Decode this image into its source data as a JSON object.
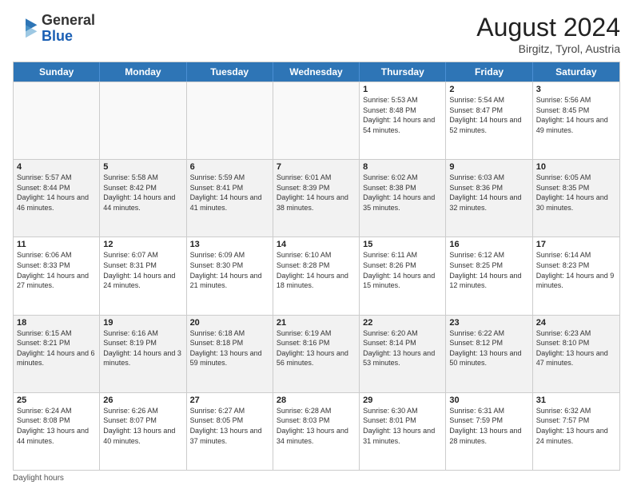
{
  "header": {
    "logo_general": "General",
    "logo_blue": "Blue",
    "month_year": "August 2024",
    "location": "Birgitz, Tyrol, Austria"
  },
  "days_of_week": [
    "Sunday",
    "Monday",
    "Tuesday",
    "Wednesday",
    "Thursday",
    "Friday",
    "Saturday"
  ],
  "weeks": [
    [
      {
        "day": "",
        "empty": true
      },
      {
        "day": "",
        "empty": true
      },
      {
        "day": "",
        "empty": true
      },
      {
        "day": "",
        "empty": true
      },
      {
        "day": "1",
        "sunrise": "5:53 AM",
        "sunset": "8:48 PM",
        "daylight": "14 hours and 54 minutes."
      },
      {
        "day": "2",
        "sunrise": "5:54 AM",
        "sunset": "8:47 PM",
        "daylight": "14 hours and 52 minutes."
      },
      {
        "day": "3",
        "sunrise": "5:56 AM",
        "sunset": "8:45 PM",
        "daylight": "14 hours and 49 minutes."
      }
    ],
    [
      {
        "day": "4",
        "sunrise": "5:57 AM",
        "sunset": "8:44 PM",
        "daylight": "14 hours and 46 minutes."
      },
      {
        "day": "5",
        "sunrise": "5:58 AM",
        "sunset": "8:42 PM",
        "daylight": "14 hours and 44 minutes."
      },
      {
        "day": "6",
        "sunrise": "5:59 AM",
        "sunset": "8:41 PM",
        "daylight": "14 hours and 41 minutes."
      },
      {
        "day": "7",
        "sunrise": "6:01 AM",
        "sunset": "8:39 PM",
        "daylight": "14 hours and 38 minutes."
      },
      {
        "day": "8",
        "sunrise": "6:02 AM",
        "sunset": "8:38 PM",
        "daylight": "14 hours and 35 minutes."
      },
      {
        "day": "9",
        "sunrise": "6:03 AM",
        "sunset": "8:36 PM",
        "daylight": "14 hours and 32 minutes."
      },
      {
        "day": "10",
        "sunrise": "6:05 AM",
        "sunset": "8:35 PM",
        "daylight": "14 hours and 30 minutes."
      }
    ],
    [
      {
        "day": "11",
        "sunrise": "6:06 AM",
        "sunset": "8:33 PM",
        "daylight": "14 hours and 27 minutes."
      },
      {
        "day": "12",
        "sunrise": "6:07 AM",
        "sunset": "8:31 PM",
        "daylight": "14 hours and 24 minutes."
      },
      {
        "day": "13",
        "sunrise": "6:09 AM",
        "sunset": "8:30 PM",
        "daylight": "14 hours and 21 minutes."
      },
      {
        "day": "14",
        "sunrise": "6:10 AM",
        "sunset": "8:28 PM",
        "daylight": "14 hours and 18 minutes."
      },
      {
        "day": "15",
        "sunrise": "6:11 AM",
        "sunset": "8:26 PM",
        "daylight": "14 hours and 15 minutes."
      },
      {
        "day": "16",
        "sunrise": "6:12 AM",
        "sunset": "8:25 PM",
        "daylight": "14 hours and 12 minutes."
      },
      {
        "day": "17",
        "sunrise": "6:14 AM",
        "sunset": "8:23 PM",
        "daylight": "14 hours and 9 minutes."
      }
    ],
    [
      {
        "day": "18",
        "sunrise": "6:15 AM",
        "sunset": "8:21 PM",
        "daylight": "14 hours and 6 minutes."
      },
      {
        "day": "19",
        "sunrise": "6:16 AM",
        "sunset": "8:19 PM",
        "daylight": "14 hours and 3 minutes."
      },
      {
        "day": "20",
        "sunrise": "6:18 AM",
        "sunset": "8:18 PM",
        "daylight": "13 hours and 59 minutes."
      },
      {
        "day": "21",
        "sunrise": "6:19 AM",
        "sunset": "8:16 PM",
        "daylight": "13 hours and 56 minutes."
      },
      {
        "day": "22",
        "sunrise": "6:20 AM",
        "sunset": "8:14 PM",
        "daylight": "13 hours and 53 minutes."
      },
      {
        "day": "23",
        "sunrise": "6:22 AM",
        "sunset": "8:12 PM",
        "daylight": "13 hours and 50 minutes."
      },
      {
        "day": "24",
        "sunrise": "6:23 AM",
        "sunset": "8:10 PM",
        "daylight": "13 hours and 47 minutes."
      }
    ],
    [
      {
        "day": "25",
        "sunrise": "6:24 AM",
        "sunset": "8:08 PM",
        "daylight": "13 hours and 44 minutes."
      },
      {
        "day": "26",
        "sunrise": "6:26 AM",
        "sunset": "8:07 PM",
        "daylight": "13 hours and 40 minutes."
      },
      {
        "day": "27",
        "sunrise": "6:27 AM",
        "sunset": "8:05 PM",
        "daylight": "13 hours and 37 minutes."
      },
      {
        "day": "28",
        "sunrise": "6:28 AM",
        "sunset": "8:03 PM",
        "daylight": "13 hours and 34 minutes."
      },
      {
        "day": "29",
        "sunrise": "6:30 AM",
        "sunset": "8:01 PM",
        "daylight": "13 hours and 31 minutes."
      },
      {
        "day": "30",
        "sunrise": "6:31 AM",
        "sunset": "7:59 PM",
        "daylight": "13 hours and 28 minutes."
      },
      {
        "day": "31",
        "sunrise": "6:32 AM",
        "sunset": "7:57 PM",
        "daylight": "13 hours and 24 minutes."
      }
    ]
  ],
  "footer": {
    "label": "Daylight hours"
  }
}
